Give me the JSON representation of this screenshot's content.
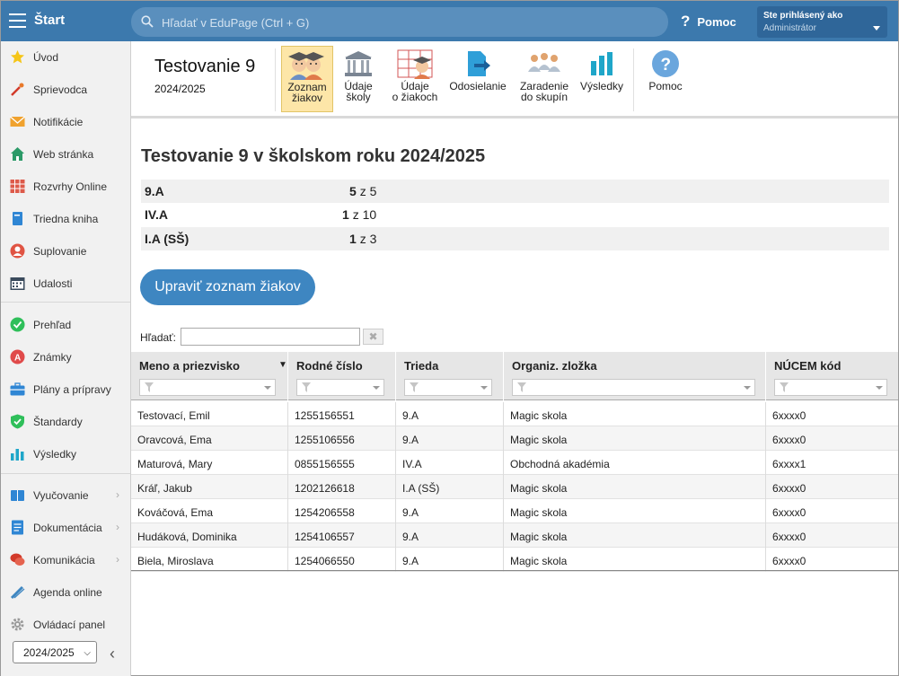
{
  "topbar": {
    "start_label": "Štart",
    "search_placeholder": "Hľadať v EduPage (Ctrl + G)",
    "help_label": "Pomoc",
    "user_line1": "Ste prihlásený ako",
    "user_line2": "Administrátor"
  },
  "sidebar": {
    "items": [
      {
        "label": "Úvod",
        "icon": "star-icon"
      },
      {
        "label": "Sprievodca",
        "icon": "wand-icon"
      },
      {
        "label": "Notifikácie",
        "icon": "envelope-icon"
      },
      {
        "label": "Web stránka",
        "icon": "house-icon"
      },
      {
        "label": "Rozvrhy Online",
        "icon": "calendar-grid-icon"
      },
      {
        "label": "Triedna kniha",
        "icon": "book-icon"
      },
      {
        "label": "Suplovanie",
        "icon": "person-icon"
      },
      {
        "label": "Udalosti",
        "icon": "calendar-icon"
      },
      {
        "label": "Prehľad",
        "icon": "check-circle-icon"
      },
      {
        "label": "Známky",
        "icon": "grade-icon"
      },
      {
        "label": "Plány a prípravy",
        "icon": "briefcase-icon"
      },
      {
        "label": "Štandardy",
        "icon": "shield-check-icon"
      },
      {
        "label": "Výsledky",
        "icon": "bar-chart-icon"
      },
      {
        "label": "Vyučovanie",
        "icon": "books-icon"
      },
      {
        "label": "Dokumentácia",
        "icon": "document-icon"
      },
      {
        "label": "Komunikácia",
        "icon": "chat-icon"
      },
      {
        "label": "Agenda online",
        "icon": "pen-icon"
      },
      {
        "label": "Ovládací panel",
        "icon": "gear-icon"
      }
    ],
    "year": "2024/2025"
  },
  "header": {
    "title": "Testovanie 9",
    "year": "2024/2025",
    "toolbar": [
      {
        "label1": "Zoznam",
        "label2": "žiakov",
        "icon": "students-icon"
      },
      {
        "label1": "Údaje",
        "label2": "školy",
        "icon": "school-icon"
      },
      {
        "label1": "Údaje",
        "label2": "o žiakoch",
        "icon": "student-data-icon"
      },
      {
        "label1": "Odosielanie",
        "label2": "",
        "icon": "send-icon"
      },
      {
        "label1": "Zaradenie",
        "label2": "do skupín",
        "icon": "groups-icon"
      },
      {
        "label1": "Výsledky",
        "label2": "",
        "icon": "results-icon"
      },
      {
        "label1": "Pomoc",
        "label2": "",
        "icon": "help-icon"
      }
    ]
  },
  "main": {
    "heading": "Testovanie 9 v školskom roku 2024/2025",
    "classes": [
      {
        "name": "9.A",
        "count": "5",
        "total": "z 5"
      },
      {
        "name": "IV.A",
        "count": "1",
        "total": "z 10"
      },
      {
        "name": "I.A (SŠ)",
        "count": "1",
        "total": "z 3"
      }
    ],
    "edit_button": "Upraviť zoznam žiakov",
    "filter_label": "Hľadať:",
    "clear_label": "✖"
  },
  "grid": {
    "columns": [
      "Meno a priezvisko",
      "Rodné číslo",
      "Trieda",
      "Organiz. zložka",
      "NÚCEM kód"
    ],
    "rows": [
      [
        "Testovací, Emil",
        "1255156551",
        "9.A",
        "Magic skola",
        "6xxxx0"
      ],
      [
        "Oravcová, Ema",
        "1255106556",
        "9.A",
        "Magic skola",
        "6xxxx0"
      ],
      [
        "Maturová, Mary",
        "0855156555",
        "IV.A",
        "Obchodná akadémia",
        "6xxxx1"
      ],
      [
        "Kráľ, Jakub",
        "1202126618",
        "I.A (SŠ)",
        "Magic skola",
        "6xxxx0"
      ],
      [
        "Kováčová, Ema",
        "1254206558",
        "9.A",
        "Magic skola",
        "6xxxx0"
      ],
      [
        "Hudáková, Dominika",
        "1254106557",
        "9.A",
        "Magic skola",
        "6xxxx0"
      ],
      [
        "Biela, Miroslava",
        "1254066550",
        "9.A",
        "Magic skola",
        "6xxxx0"
      ]
    ]
  }
}
